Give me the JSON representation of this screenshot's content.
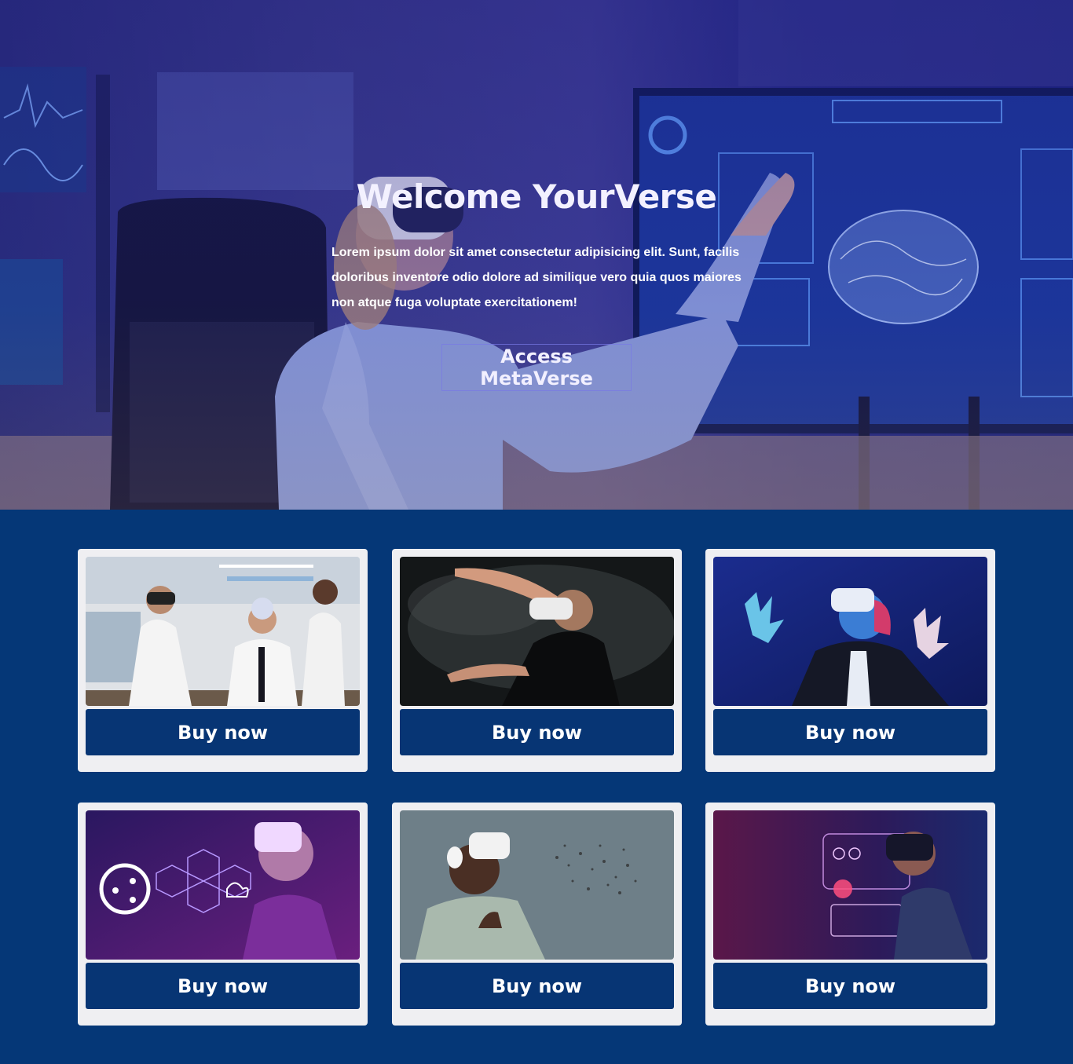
{
  "hero": {
    "title": "Welcome YourVerse",
    "text": "Lorem ipsum dolor sit amet consectetur adipisicing elit. Sunt, facilis doloribus inventore odio dolore ad similique vero quia quos maiores non atque fuga voluptate exercitationem!",
    "cta_label": "Access MetaVerse",
    "background": "vr-lab-scene-image"
  },
  "products": [
    {
      "image": "lab-vr-headset-image",
      "button_label": "Buy now"
    },
    {
      "image": "smoke-vr-user-image",
      "button_label": "Buy now"
    },
    {
      "image": "neon-vr-user-image",
      "button_label": "Buy now"
    },
    {
      "image": "purple-network-vr-image",
      "button_label": "Buy now"
    },
    {
      "image": "headphones-vr-user-image",
      "button_label": "Buy now"
    },
    {
      "image": "holographic-vr-user-image",
      "button_label": "Buy now"
    }
  ],
  "colors": {
    "page_background": "#053777",
    "card_background": "#efeff2",
    "button_background": "#073574",
    "hero_tint": "#2a2f7e"
  }
}
